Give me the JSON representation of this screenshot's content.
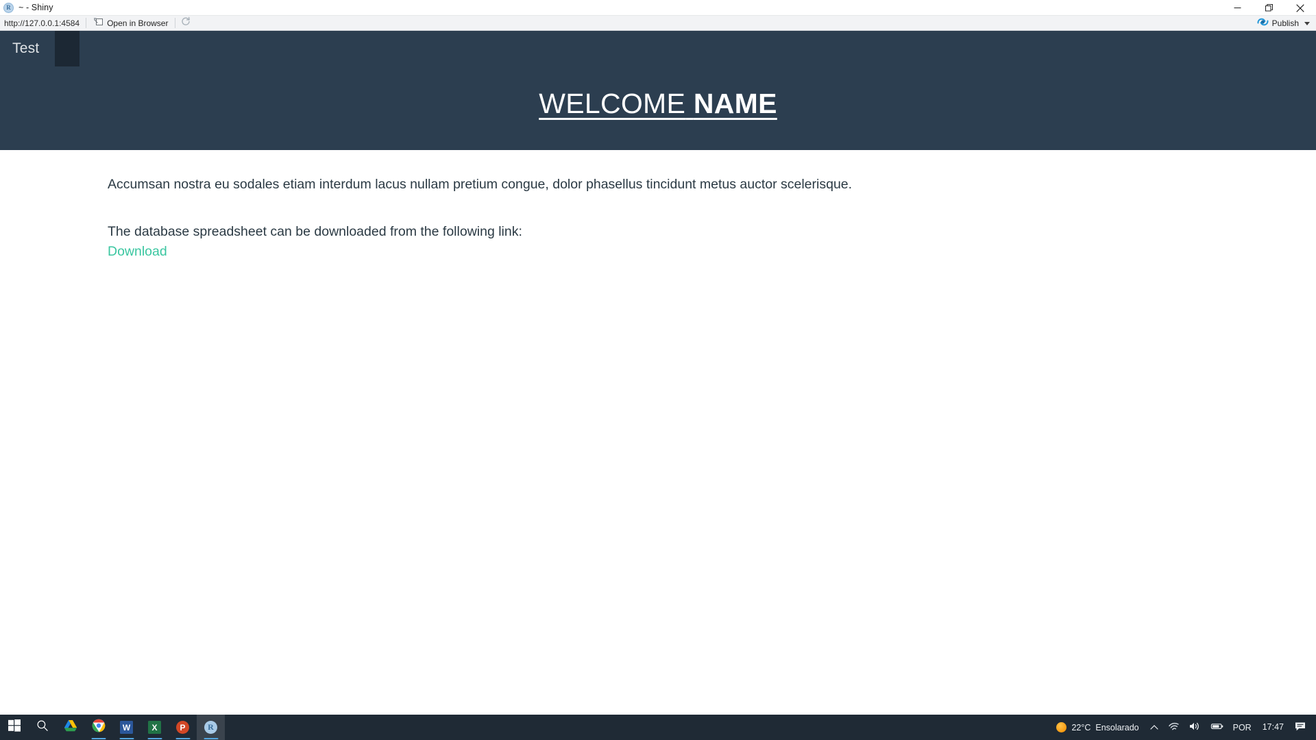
{
  "window": {
    "title": "~ - Shiny",
    "app_icon": "r-logo-icon",
    "controls": {
      "minimize": "minimize-icon",
      "maximize": "maximize-icon",
      "close": "close-icon"
    }
  },
  "viewer_toolbar": {
    "url": "http://127.0.0.1:4584",
    "open_in_browser_label": "Open in Browser",
    "open_in_browser_icon": "external-window-icon",
    "refresh_icon": "refresh-icon",
    "publish_label": "Publish",
    "publish_icon": "publish-icon",
    "publish_caret": "chevron-down-icon"
  },
  "shiny_app": {
    "navbar": {
      "brand": "Test",
      "background_color": "#2c3e50",
      "active_tab_color": "#1c2834"
    },
    "heading": {
      "word_1": "WELCOME",
      "word_2": "NAME"
    },
    "content": {
      "intro_paragraph": "Accumsan nostra eu sodales etiam interdum lacus nullam pretium congue, dolor phasellus tincidunt metus auctor scelerisque.",
      "download_prompt": "The database spreadsheet can be downloaded from the following link:",
      "download_link_label": "Download",
      "download_link_color": "#3ac6a0"
    }
  },
  "taskbar": {
    "items": [
      {
        "name": "start-button",
        "icon": "windows-logo-icon",
        "label": "",
        "running": false
      },
      {
        "name": "search-button",
        "icon": "search-icon",
        "label": "",
        "running": false
      },
      {
        "name": "google-drive",
        "icon": "google-drive-icon",
        "label": "",
        "running": false
      },
      {
        "name": "google-chrome",
        "icon": "chrome-icon",
        "label": "",
        "running": true
      },
      {
        "name": "microsoft-word",
        "icon": "word-icon",
        "label": "W",
        "running": true
      },
      {
        "name": "microsoft-excel",
        "icon": "excel-icon",
        "label": "X",
        "running": true
      },
      {
        "name": "microsoft-powerpoint",
        "icon": "powerpoint-icon",
        "label": "P",
        "running": true
      },
      {
        "name": "rstudio",
        "icon": "r-logo-icon",
        "label": "R",
        "running": true
      }
    ],
    "tray": {
      "weather_icon": "sun-icon",
      "temperature": "22°C",
      "weather_condition": "Ensolarado",
      "overflow_icon": "chevron-up-icon",
      "network_icon": "wifi-icon",
      "volume_icon": "speaker-icon",
      "battery_icon": "battery-icon",
      "language": "POR",
      "time": "17:47",
      "notifications_icon": "notification-icon"
    }
  }
}
